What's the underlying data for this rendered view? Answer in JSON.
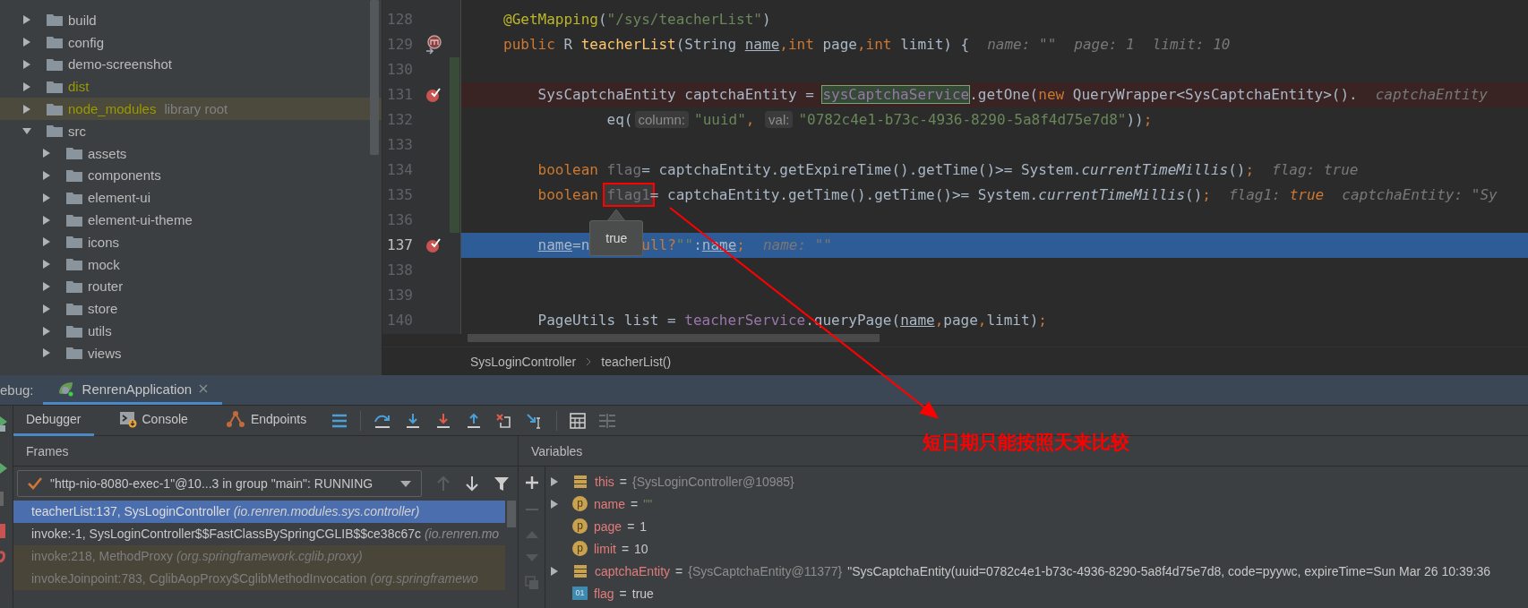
{
  "project_tree": [
    {
      "label": "build",
      "excluded": false,
      "expanded": false,
      "selected": false
    },
    {
      "label": "config",
      "excluded": false,
      "expanded": false,
      "selected": false
    },
    {
      "label": "demo-screenshot",
      "excluded": false,
      "expanded": false,
      "selected": false
    },
    {
      "label": "dist",
      "excluded": true,
      "expanded": false,
      "selected": false
    },
    {
      "label": "node_modules",
      "excluded": true,
      "note": "library root",
      "expanded": false,
      "selected": true
    },
    {
      "label": "src",
      "excluded": false,
      "expanded": true,
      "selected": false,
      "children": [
        {
          "label": "assets",
          "excluded": false,
          "expanded": false,
          "selected": false
        },
        {
          "label": "components",
          "excluded": false,
          "expanded": false,
          "selected": false
        },
        {
          "label": "element-ui",
          "excluded": false,
          "expanded": false,
          "selected": false
        },
        {
          "label": "element-ui-theme",
          "excluded": false,
          "expanded": false,
          "selected": false
        },
        {
          "label": "icons",
          "excluded": false,
          "expanded": false,
          "selected": false
        },
        {
          "label": "mock",
          "excluded": false,
          "expanded": false,
          "selected": false
        },
        {
          "label": "router",
          "excluded": false,
          "expanded": false,
          "selected": false
        },
        {
          "label": "store",
          "excluded": false,
          "expanded": false,
          "selected": false
        },
        {
          "label": "utils",
          "excluded": false,
          "expanded": false,
          "selected": false
        },
        {
          "label": "views",
          "excluded": false,
          "expanded": false,
          "selected": false
        }
      ]
    }
  ],
  "editor": {
    "lines": [
      {
        "number": "128",
        "breakpoint": false,
        "method_breakpoint": false,
        "current": false,
        "changed": false,
        "tokens": [
          {
            "kind": "annotation",
            "text": "@GetMapping"
          },
          {
            "kind": "plain",
            "text": "("
          },
          {
            "kind": "string",
            "text": "\"/sys/teacherList\""
          },
          {
            "kind": "plain",
            "text": ")"
          }
        ]
      },
      {
        "number": "129",
        "breakpoint": false,
        "method_breakpoint": true,
        "current": false,
        "changed": false,
        "tokens": [
          {
            "kind": "keyword",
            "text": "public "
          },
          {
            "kind": "plain",
            "text": "R "
          },
          {
            "kind": "method",
            "text": "teacherList"
          },
          {
            "kind": "plain",
            "text": "(String "
          },
          {
            "kind": "param",
            "text": "name"
          },
          {
            "kind": "keyword",
            "text": ",int "
          },
          {
            "kind": "plain",
            "text": "page"
          },
          {
            "kind": "keyword",
            "text": ",int "
          },
          {
            "kind": "plain",
            "text": "limit) {"
          },
          {
            "kind": "hint",
            "text": "name: \"\""
          },
          {
            "kind": "hint",
            "text": "page: 1"
          },
          {
            "kind": "hint",
            "text": "limit: 10"
          }
        ]
      },
      {
        "number": "130",
        "breakpoint": false,
        "method_breakpoint": false,
        "current": false,
        "changed": true
      },
      {
        "number": "131",
        "breakpoint": true,
        "method_breakpoint": false,
        "current": false,
        "changed": true,
        "tokens": [
          {
            "kind": "plain",
            "text": "    SysCaptchaEntity captchaEntity = "
          },
          {
            "kind": "field_boxed",
            "text": "sysCaptchaService"
          },
          {
            "kind": "plain",
            "text": ".getOne("
          },
          {
            "kind": "keyword",
            "text": "new "
          },
          {
            "kind": "plain",
            "text": "QueryWrapper<SysCaptchaEntity>()."
          },
          {
            "kind": "hint",
            "text": "captchaEntity"
          }
        ]
      },
      {
        "number": "132",
        "breakpoint": false,
        "method_breakpoint": false,
        "current": false,
        "changed": true,
        "tokens": [
          {
            "kind": "plain",
            "text": "            eq("
          },
          {
            "kind": "param_hint",
            "text": "column:"
          },
          {
            "kind": "string",
            "text": "\"uuid\""
          },
          {
            "kind": "keyword",
            "text": ", "
          },
          {
            "kind": "param_hint",
            "text": "val:"
          },
          {
            "kind": "string",
            "text": "\"0782c4e1-b73c-4936-8290-5a8f4d75e7d8\""
          },
          {
            "kind": "plain",
            "text": "))"
          },
          {
            "kind": "keyword",
            "text": ";"
          }
        ]
      },
      {
        "number": "133",
        "breakpoint": false,
        "method_breakpoint": false,
        "current": false,
        "changed": true
      },
      {
        "number": "134",
        "breakpoint": false,
        "method_breakpoint": false,
        "current": false,
        "changed": true,
        "tokens": [
          {
            "kind": "keyword",
            "text": "    boolean "
          },
          {
            "kind": "unused",
            "text": "flag"
          },
          {
            "kind": "plain",
            "text": "= captchaEntity.getExpireTime().getTime()>= System."
          },
          {
            "kind": "static",
            "text": "currentTimeMillis"
          },
          {
            "kind": "plain",
            "text": "()"
          },
          {
            "kind": "keyword",
            "text": ";"
          },
          {
            "kind": "hint",
            "text": "flag: true"
          }
        ]
      },
      {
        "number": "135",
        "breakpoint": false,
        "method_breakpoint": false,
        "current": false,
        "changed": true,
        "tokens": [
          {
            "kind": "keyword",
            "text": "    boolean "
          },
          {
            "kind": "unused_marked",
            "text": "flag1"
          },
          {
            "kind": "plain",
            "text": "= captchaEntity.getTime().getTime()>= System."
          },
          {
            "kind": "static",
            "text": "currentTimeMillis"
          },
          {
            "kind": "plain",
            "text": "()"
          },
          {
            "kind": "keyword",
            "text": ";"
          },
          {
            "kind": "hint",
            "text": "flag1:"
          },
          {
            "kind": "hint_value",
            "text": "true"
          },
          {
            "kind": "hint",
            "text": "captchaEntity: \"Sy"
          }
        ]
      },
      {
        "number": "136",
        "breakpoint": false,
        "method_breakpoint": false,
        "current": false,
        "changed": true
      },
      {
        "number": "137",
        "breakpoint": true,
        "method_breakpoint": false,
        "current": true,
        "changed": false,
        "tokens": [
          {
            "kind": "param",
            "text": "    name"
          },
          {
            "kind": "plain",
            "text": "=n"
          },
          {
            "kind": "covered"
          },
          {
            "kind": "keyword",
            "text": "ull?"
          },
          {
            "kind": "string",
            "text": "\"\""
          },
          {
            "kind": "plain",
            "text": ":"
          },
          {
            "kind": "param",
            "text": "name"
          },
          {
            "kind": "keyword",
            "text": ";"
          },
          {
            "kind": "hint",
            "text": "name: \"\""
          }
        ]
      },
      {
        "number": "138",
        "breakpoint": false,
        "method_breakpoint": false,
        "current": false,
        "changed": false
      },
      {
        "number": "139",
        "breakpoint": false,
        "method_breakpoint": false,
        "current": false,
        "changed": false
      },
      {
        "number": "140",
        "breakpoint": false,
        "method_breakpoint": false,
        "current": false,
        "changed": false,
        "tokens": [
          {
            "kind": "plain",
            "text": "    PageUtils list = "
          },
          {
            "kind": "field",
            "text": "teacherService"
          },
          {
            "kind": "plain",
            "text": ".queryPage("
          },
          {
            "kind": "param",
            "text": "name"
          },
          {
            "kind": "keyword",
            "text": ","
          },
          {
            "kind": "plain",
            "text": "page"
          },
          {
            "kind": "keyword",
            "text": ","
          },
          {
            "kind": "plain",
            "text": "limit)"
          },
          {
            "kind": "keyword",
            "text": ";"
          }
        ]
      }
    ],
    "tooltip": "true",
    "breadcrumbs": [
      "SysLoginController",
      "teacherList()"
    ]
  },
  "callout": "短日期只能按照天来比较",
  "debug": {
    "label": "ebug:",
    "tabs": [
      {
        "label": "RenrenApplication",
        "selected": true
      }
    ],
    "view_tabs": [
      {
        "label": "Debugger",
        "kind": "debugger",
        "selected": true
      },
      {
        "label": "Console",
        "kind": "console",
        "selected": false
      },
      {
        "label": "Endpoints",
        "kind": "endpoints",
        "selected": false
      }
    ],
    "frames": {
      "title": "Frames",
      "thread": "\"http-nio-8080-exec-1\"@10...3 in group \"main\": RUNNING",
      "items": [
        {
          "method": "teacherList:137, SysLoginController",
          "package": "(io.renren.modules.sys.controller)",
          "selected": true,
          "library": false
        },
        {
          "method": "invoke:-1, SysLoginController$$FastClassBySpringCGLIB$$ce38c67c",
          "package": "(io.renren.mo",
          "selected": false,
          "library": false
        },
        {
          "method": "invoke:218, MethodProxy",
          "package": "(org.springframework.cglib.proxy)",
          "selected": false,
          "library": true
        },
        {
          "method": "invokeJoinpoint:783, CglibAopProxy$CglibMethodInvocation",
          "package": "(org.springframewo",
          "selected": false,
          "library": true
        }
      ]
    },
    "variables": {
      "title": "Variables",
      "items": [
        {
          "name": "this",
          "kind": "object",
          "expandable": true,
          "sign": "=",
          "ref": "{SysLoginController@10985}"
        },
        {
          "name": "name",
          "kind": "param",
          "icon_text": "p",
          "expandable": true,
          "sign": "=",
          "value": "\"\"",
          "is_string": true
        },
        {
          "name": "page",
          "kind": "param",
          "icon_text": "p",
          "expandable": false,
          "sign": "=",
          "value": "1",
          "is_string": false
        },
        {
          "name": "limit",
          "kind": "param",
          "icon_text": "p",
          "expandable": false,
          "sign": "=",
          "value": "10",
          "is_string": false
        },
        {
          "name": "captchaEntity",
          "kind": "object",
          "expandable": true,
          "sign": "=",
          "ref": "{SysCaptchaEntity@11377}",
          "value": "\"SysCaptchaEntity(uuid=0782c4e1-b73c-4936-8290-5a8f4d75e7d8, code=pyywc, expireTime=Sun Mar 26 10:39:36",
          "is_string": false
        },
        {
          "name": "flag",
          "kind": "primitive",
          "icon_text": "01",
          "expandable": false,
          "sign": "=",
          "value": "true",
          "is_string": false
        }
      ]
    }
  }
}
